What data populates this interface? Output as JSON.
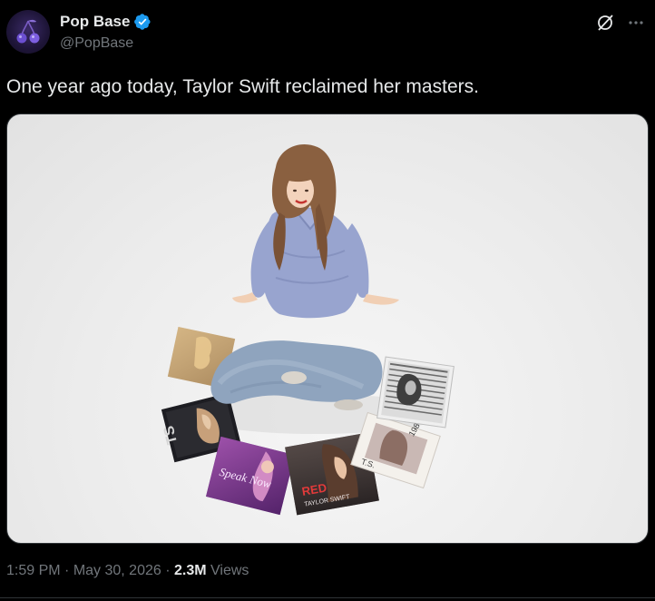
{
  "author": {
    "display_name": "Pop Base",
    "handle": "@PopBase",
    "verified": true,
    "avatar_icon": "cherries-icon"
  },
  "actions": {
    "grok_icon": "grok-icon",
    "more_icon": "more-horizontal-icon"
  },
  "tweet": {
    "text": "One year ago today, Taylor Swift reclaimed her masters."
  },
  "media": {
    "album_labels": {
      "red_title": "RED",
      "red_artist": "TAYLOR SWIFT",
      "speak_now_script": "Speak Now",
      "ts_initials": "T.S.",
      "year_1989": "1989"
    }
  },
  "meta": {
    "time": "1:59 PM",
    "separator1": " · ",
    "date": "May 30, 2026",
    "separator2": " · ",
    "views_count": "2.3M",
    "views_label": " Views"
  },
  "colors": {
    "background": "#000000",
    "primary_text": "#e7e9ea",
    "secondary_text": "#71767b",
    "verified_blue": "#1d9bf0",
    "border": "#2f3336"
  }
}
